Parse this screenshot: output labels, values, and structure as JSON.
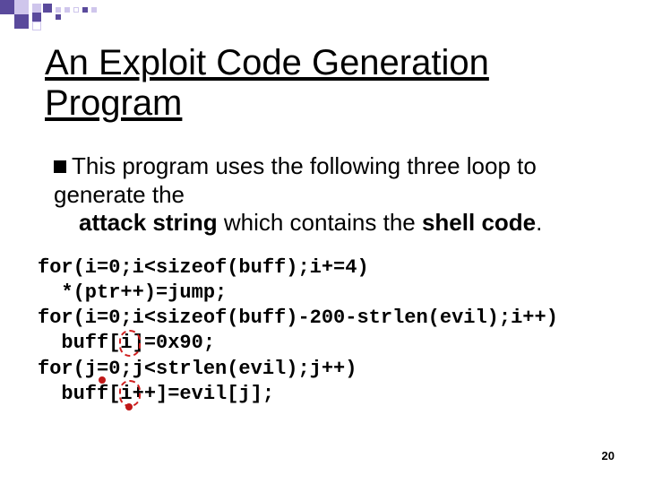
{
  "title_line1": "An Exploit Code Generation",
  "title_line2": "Program",
  "bullet_pre": "This program uses the following three loop to generate the ",
  "bullet_bold1": "attack string",
  "bullet_mid": " which contains the ",
  "bullet_bold2": "shell code",
  "bullet_post": ".",
  "code": {
    "l1": "for(i=0;i<sizeof(buff);i+=4)",
    "l2": "  *(ptr++)=jump;",
    "l3": "for(i=0;i<sizeof(buff)-200-strlen(evil);i++)",
    "l4": "  buff[i]=0x90;",
    "l5": "for(j=0;j<strlen(evil);j++)",
    "l6": "  buff[i++]=evil[j];"
  },
  "page_number": "20"
}
